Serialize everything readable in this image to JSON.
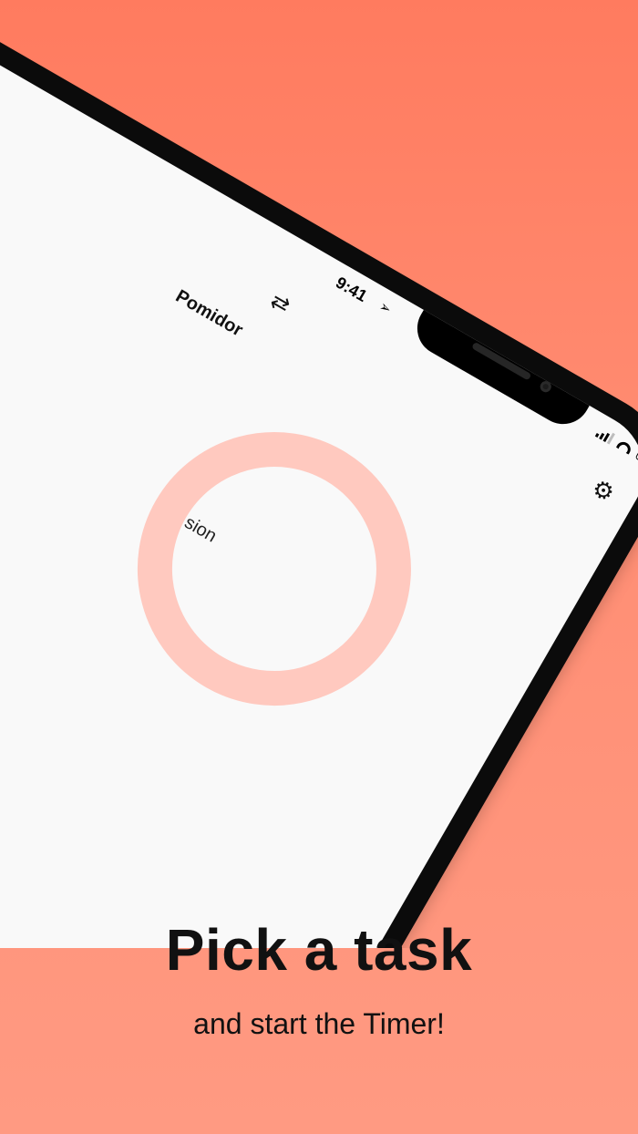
{
  "statusbar": {
    "time": "9:41",
    "location_icon": "location-arrow-icon",
    "signal_icon": "cellular-signal-icon",
    "wifi_icon": "wifi-icon",
    "battery_icon": "battery-icon"
  },
  "app": {
    "title": "Pomidor",
    "swap_icon": "swap-arrows-icon",
    "settings_icon": "gear-icon",
    "ring_label": "sion",
    "ring_color": "#FFC9BF"
  },
  "marketing": {
    "headline": "Pick a task",
    "subline": "and start the Timer!",
    "background_color": "#FF8A70"
  }
}
